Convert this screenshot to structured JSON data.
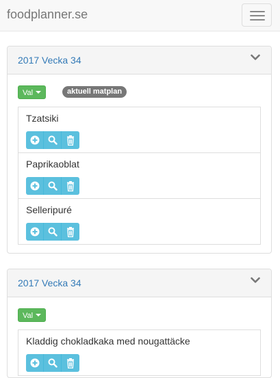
{
  "navbar": {
    "brand": "foodplanner.se",
    "menu_icon": "hamburger-icon"
  },
  "colors": {
    "link": "#337ab7",
    "success": "#5cb85c",
    "info": "#5bc0de",
    "badge": "#777777",
    "panel_heading": "#f5f5f5"
  },
  "plans": [
    {
      "title": "2017 Vecka 34",
      "val_label": "Val",
      "badge": "aktuell matplan",
      "recipes": [
        {
          "name": "Tzatsiki"
        },
        {
          "name": "Paprikaoblat"
        },
        {
          "name": "Selleripuré"
        }
      ]
    },
    {
      "title": "2017 Vecka 34",
      "val_label": "Val",
      "recipes": [
        {
          "name": "Kladdig chokladkaka med nougattäcke"
        }
      ]
    }
  ],
  "recipe_actions": [
    "plus-circle-icon",
    "search-icon",
    "trash-icon"
  ]
}
